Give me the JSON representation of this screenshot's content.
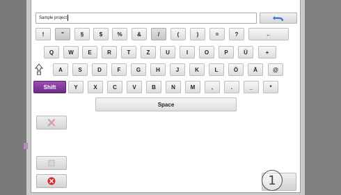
{
  "text_input": {
    "value": "Sample project"
  },
  "keyboard": {
    "row1": [
      "!",
      "\"",
      "§",
      "$",
      "%",
      "&",
      "/",
      "(",
      ")",
      "=",
      "?",
      "←"
    ],
    "row2": [
      "Q",
      "W",
      "E",
      "R",
      "T",
      "Z",
      "U",
      "I",
      "O",
      "P",
      "Ü",
      "+"
    ],
    "row3": [
      "A",
      "S",
      "D",
      "F",
      "G",
      "H",
      "J",
      "K",
      "L",
      "Ö",
      "Ä",
      "@"
    ],
    "row4": [
      "Shift",
      "Y",
      "X",
      "C",
      "V",
      "B",
      "N",
      "M",
      ",",
      ".",
      "_",
      "*"
    ],
    "space": "Space"
  },
  "callout": {
    "label": "1"
  },
  "colors": {
    "shift": "#7a3693",
    "close": "#d32b2b",
    "undo": "#3b6fd0"
  }
}
